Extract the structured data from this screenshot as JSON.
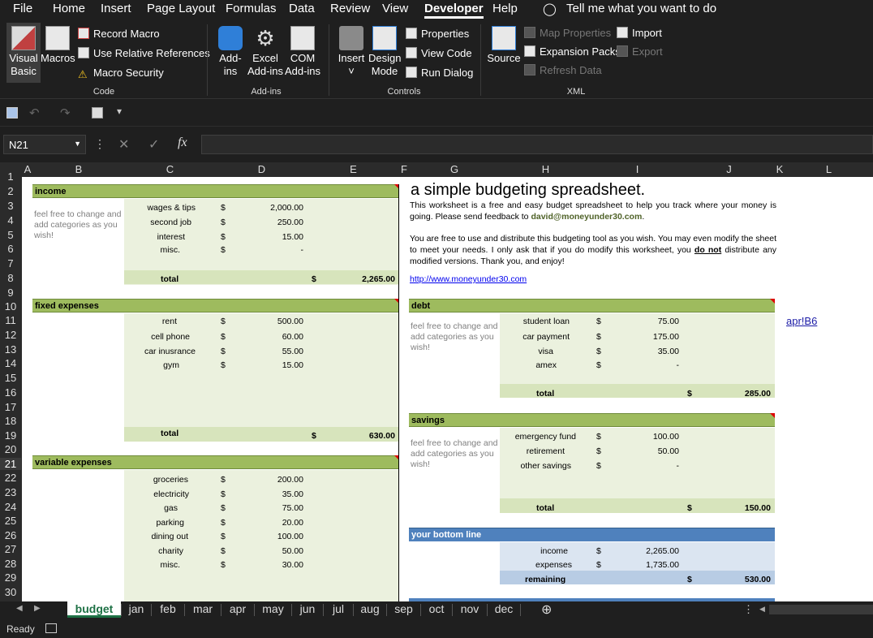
{
  "menu": {
    "file": "File",
    "home": "Home",
    "insert": "Insert",
    "page_layout": "Page Layout",
    "formulas": "Formulas",
    "data": "Data",
    "review": "Review",
    "view": "View",
    "developer": "Developer",
    "help": "Help",
    "tell": "Tell me what you want to do"
  },
  "ribbon": {
    "visual_basic": [
      "Visual",
      "Basic"
    ],
    "macros": "Macros",
    "record_macro": "Record Macro",
    "relative_refs": "Use Relative References",
    "macro_security": "Macro Security",
    "grp_code": "Code",
    "addins": [
      "Add-",
      "ins"
    ],
    "excel_addins": [
      "Excel",
      "Add-ins"
    ],
    "com_addins": [
      "COM",
      "Add-ins"
    ],
    "grp_addins": "Add-ins",
    "insert": "Insert",
    "design_mode": [
      "Design",
      "Mode"
    ],
    "properties": "Properties",
    "view_code": "View Code",
    "run_dialog": "Run Dialog",
    "grp_controls": "Controls",
    "source": "Source",
    "map_properties": "Map Properties",
    "expansion_packs": "Expansion Packs",
    "refresh_data": "Refresh Data",
    "import": "Import",
    "export": "Export",
    "grp_xml": "XML"
  },
  "namebox": "N21",
  "fx": "fx",
  "columns": [
    "A",
    "B",
    "C",
    "D",
    "E",
    "F",
    "G",
    "H",
    "I",
    "J",
    "K",
    "L"
  ],
  "rows": [
    "1",
    "2",
    "3",
    "4",
    "5",
    "6",
    "7",
    "8",
    "9",
    "10",
    "11",
    "12",
    "13",
    "14",
    "15",
    "16",
    "17",
    "18",
    "19",
    "20",
    "21",
    "22",
    "23",
    "24",
    "25",
    "26",
    "27",
    "28",
    "29",
    "30"
  ],
  "sheet": {
    "title": "a simple budgeting spreadsheet.",
    "intro1": "This worksheet is a free and easy budget spreadsheet to help you track where your money is going. Please send feedback to ",
    "email": "david@moneyunder30.com",
    "intro2": "You are free to use and distribute this budgeting tool as you wish. You may even modify the sheet to meet your needs. I only ask that if you do modify this worksheet, you ",
    "do_not": "do not",
    "intro3": " distribute any modified versions. Thank you, and enjoy!",
    "url": "http://www.moneyunder30.com",
    "note": "feel free to change and add categories as you wish!",
    "dollar": "$",
    "total_label": "total",
    "link_cell": "apr!B6",
    "income": {
      "header": "income",
      "items": [
        {
          "label": "wages & tips",
          "value": "2,000.00"
        },
        {
          "label": "second job",
          "value": "250.00"
        },
        {
          "label": "interest",
          "value": "15.00"
        },
        {
          "label": "misc.",
          "value": "-"
        }
      ],
      "total": "2,265.00"
    },
    "fixed": {
      "header": "fixed expenses",
      "items": [
        {
          "label": "rent",
          "value": "500.00"
        },
        {
          "label": "cell phone",
          "value": "60.00"
        },
        {
          "label": "car inusrance",
          "value": "55.00"
        },
        {
          "label": "gym",
          "value": "15.00"
        }
      ],
      "total": "630.00"
    },
    "variable": {
      "header": "variable expenses",
      "items": [
        {
          "label": "groceries",
          "value": "200.00"
        },
        {
          "label": "electricity",
          "value": "35.00"
        },
        {
          "label": "gas",
          "value": "75.00"
        },
        {
          "label": "parking",
          "value": "20.00"
        },
        {
          "label": "dining out",
          "value": "100.00"
        },
        {
          "label": "charity",
          "value": "50.00"
        },
        {
          "label": "misc.",
          "value": "30.00"
        }
      ]
    },
    "debt": {
      "header": "debt",
      "items": [
        {
          "label": "student loan",
          "value": "75.00"
        },
        {
          "label": "car payment",
          "value": "175.00"
        },
        {
          "label": "visa",
          "value": "35.00"
        },
        {
          "label": "amex",
          "value": "-"
        }
      ],
      "total": "285.00"
    },
    "savings": {
      "header": "savings",
      "items": [
        {
          "label": "emergency fund",
          "value": "100.00"
        },
        {
          "label": "retirement",
          "value": "50.00"
        },
        {
          "label": "other savings",
          "value": "-"
        }
      ],
      "total": "150.00"
    },
    "bottom": {
      "header": "your bottom line",
      "income_label": "income",
      "income": "2,265.00",
      "expenses_label": "expenses",
      "expenses": "1,735.00",
      "remaining_label": "remaining",
      "remaining": "530.00"
    }
  },
  "tabs": [
    "budget",
    "jan",
    "feb",
    "mar",
    "apr",
    "may",
    "jun",
    "jul",
    "aug",
    "sep",
    "oct",
    "nov",
    "dec"
  ],
  "status": "Ready",
  "colors": {
    "green_header": "#9ebb5e",
    "green_fill": "#ebf1de",
    "blue_header": "#4f81bd",
    "blue_fill": "#dbe5f1",
    "tab_green": "#1e7145"
  }
}
